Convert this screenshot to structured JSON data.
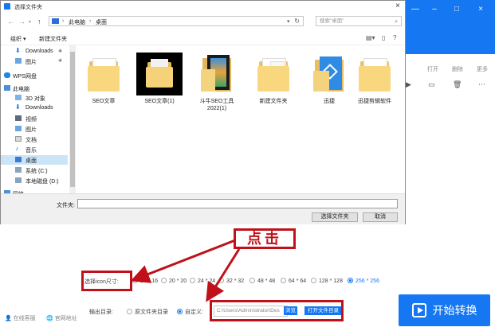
{
  "dialog": {
    "title": "选择文件夹",
    "breadcrumb": [
      "此电脑",
      "桌面"
    ],
    "search_placeholder": "搜索\"桌面\"",
    "toolbar": {
      "organize": "组织 ▾",
      "new_folder": "新建文件夹"
    },
    "nav_items": [
      {
        "label": "Downloads",
        "pinned": true,
        "icon": "download-icon"
      },
      {
        "label": "图片",
        "pinned": true,
        "icon": "picture-icon"
      },
      {
        "label": "WPS网盘",
        "pinned": false,
        "icon": "cloud-icon"
      },
      {
        "label": "此电脑",
        "pinned": false,
        "icon": "computer-icon"
      },
      {
        "label": "3D 对象",
        "pinned": false,
        "icon": "cube-icon"
      },
      {
        "label": "Downloads",
        "pinned": false,
        "icon": "download-icon"
      },
      {
        "label": "视频",
        "pinned": false,
        "icon": "video-icon"
      },
      {
        "label": "图片",
        "pinned": false,
        "icon": "picture-icon"
      },
      {
        "label": "文档",
        "pinned": false,
        "icon": "document-icon"
      },
      {
        "label": "音乐",
        "pinned": false,
        "icon": "music-icon"
      },
      {
        "label": "桌面",
        "pinned": false,
        "icon": "desktop-icon",
        "selected": true
      },
      {
        "label": "系统 (C:)",
        "pinned": false,
        "icon": "drive-icon"
      },
      {
        "label": "本地磁盘 (D:)",
        "pinned": false,
        "icon": "drive-icon"
      },
      {
        "label": "网络",
        "pinned": false,
        "icon": "network-icon"
      }
    ],
    "files": [
      {
        "label": "SEO文章",
        "kind": "folder"
      },
      {
        "label": "SEO文章(1)",
        "kind": "dark"
      },
      {
        "label": "斗牛SEO工具2022(1)",
        "kind": "media"
      },
      {
        "label": "新建文件夹",
        "kind": "folder"
      },
      {
        "label": "迅捷",
        "kind": "blue"
      },
      {
        "label": "迅捷剪辑软件",
        "kind": "folder"
      }
    ],
    "filename_label": "文件夹:",
    "filename_value": "",
    "select_button": "选择文件夹",
    "cancel_button": "取消"
  },
  "background_app": {
    "toolbar_labels": [
      "打开",
      "删除",
      "更多"
    ],
    "icon_size": {
      "label": "选择icon尺寸:",
      "options": [
        "16 * 16",
        "20 * 20",
        "24 * 24",
        "32 * 32",
        "48 * 48",
        "64 * 64",
        "128 * 128",
        "256 * 256"
      ],
      "selected": "256 * 256"
    },
    "output": {
      "label": "输出目录:",
      "original_dir": "原文件夹目录",
      "custom": "自定义:",
      "path": "C:\\Users\\Administrator\\Des",
      "browse": "浏览",
      "open_folder": "打开文件目录"
    },
    "start_button": "开始转换",
    "footer": {
      "online_service": "在线客服",
      "website": "官网地址"
    }
  },
  "annotation": {
    "text": "点击"
  },
  "colors": {
    "accent": "#1677f2",
    "annotation_red": "#c0111a",
    "folder_yellow": "#f8d77f"
  }
}
